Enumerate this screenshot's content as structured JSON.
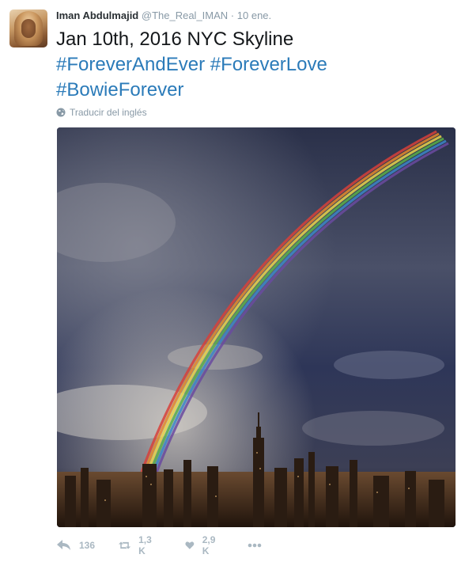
{
  "user": {
    "name": "Iman Abdulmajid",
    "handle": "@The_Real_IMAN",
    "separator": "·",
    "time": "10 ene."
  },
  "tweet": {
    "line1": "Jan 10th, 2016 NYC Skyline",
    "hashtags": [
      "#ForeverAndEver",
      "#ForeverLove",
      "#BowieForever"
    ]
  },
  "translate_label": "Traducir del inglés",
  "actions": {
    "reply_count": "136",
    "retweet_count": "1,3 K",
    "like_count": "2,9 K"
  },
  "icons": {
    "globe": "globe-icon",
    "reply": "reply-icon",
    "retweet": "retweet-icon",
    "like": "heart-icon",
    "more": "more-icon"
  },
  "colors": {
    "hashtag": "#2b7bb9",
    "meta": "#8899a6",
    "action": "#aab8c2"
  }
}
